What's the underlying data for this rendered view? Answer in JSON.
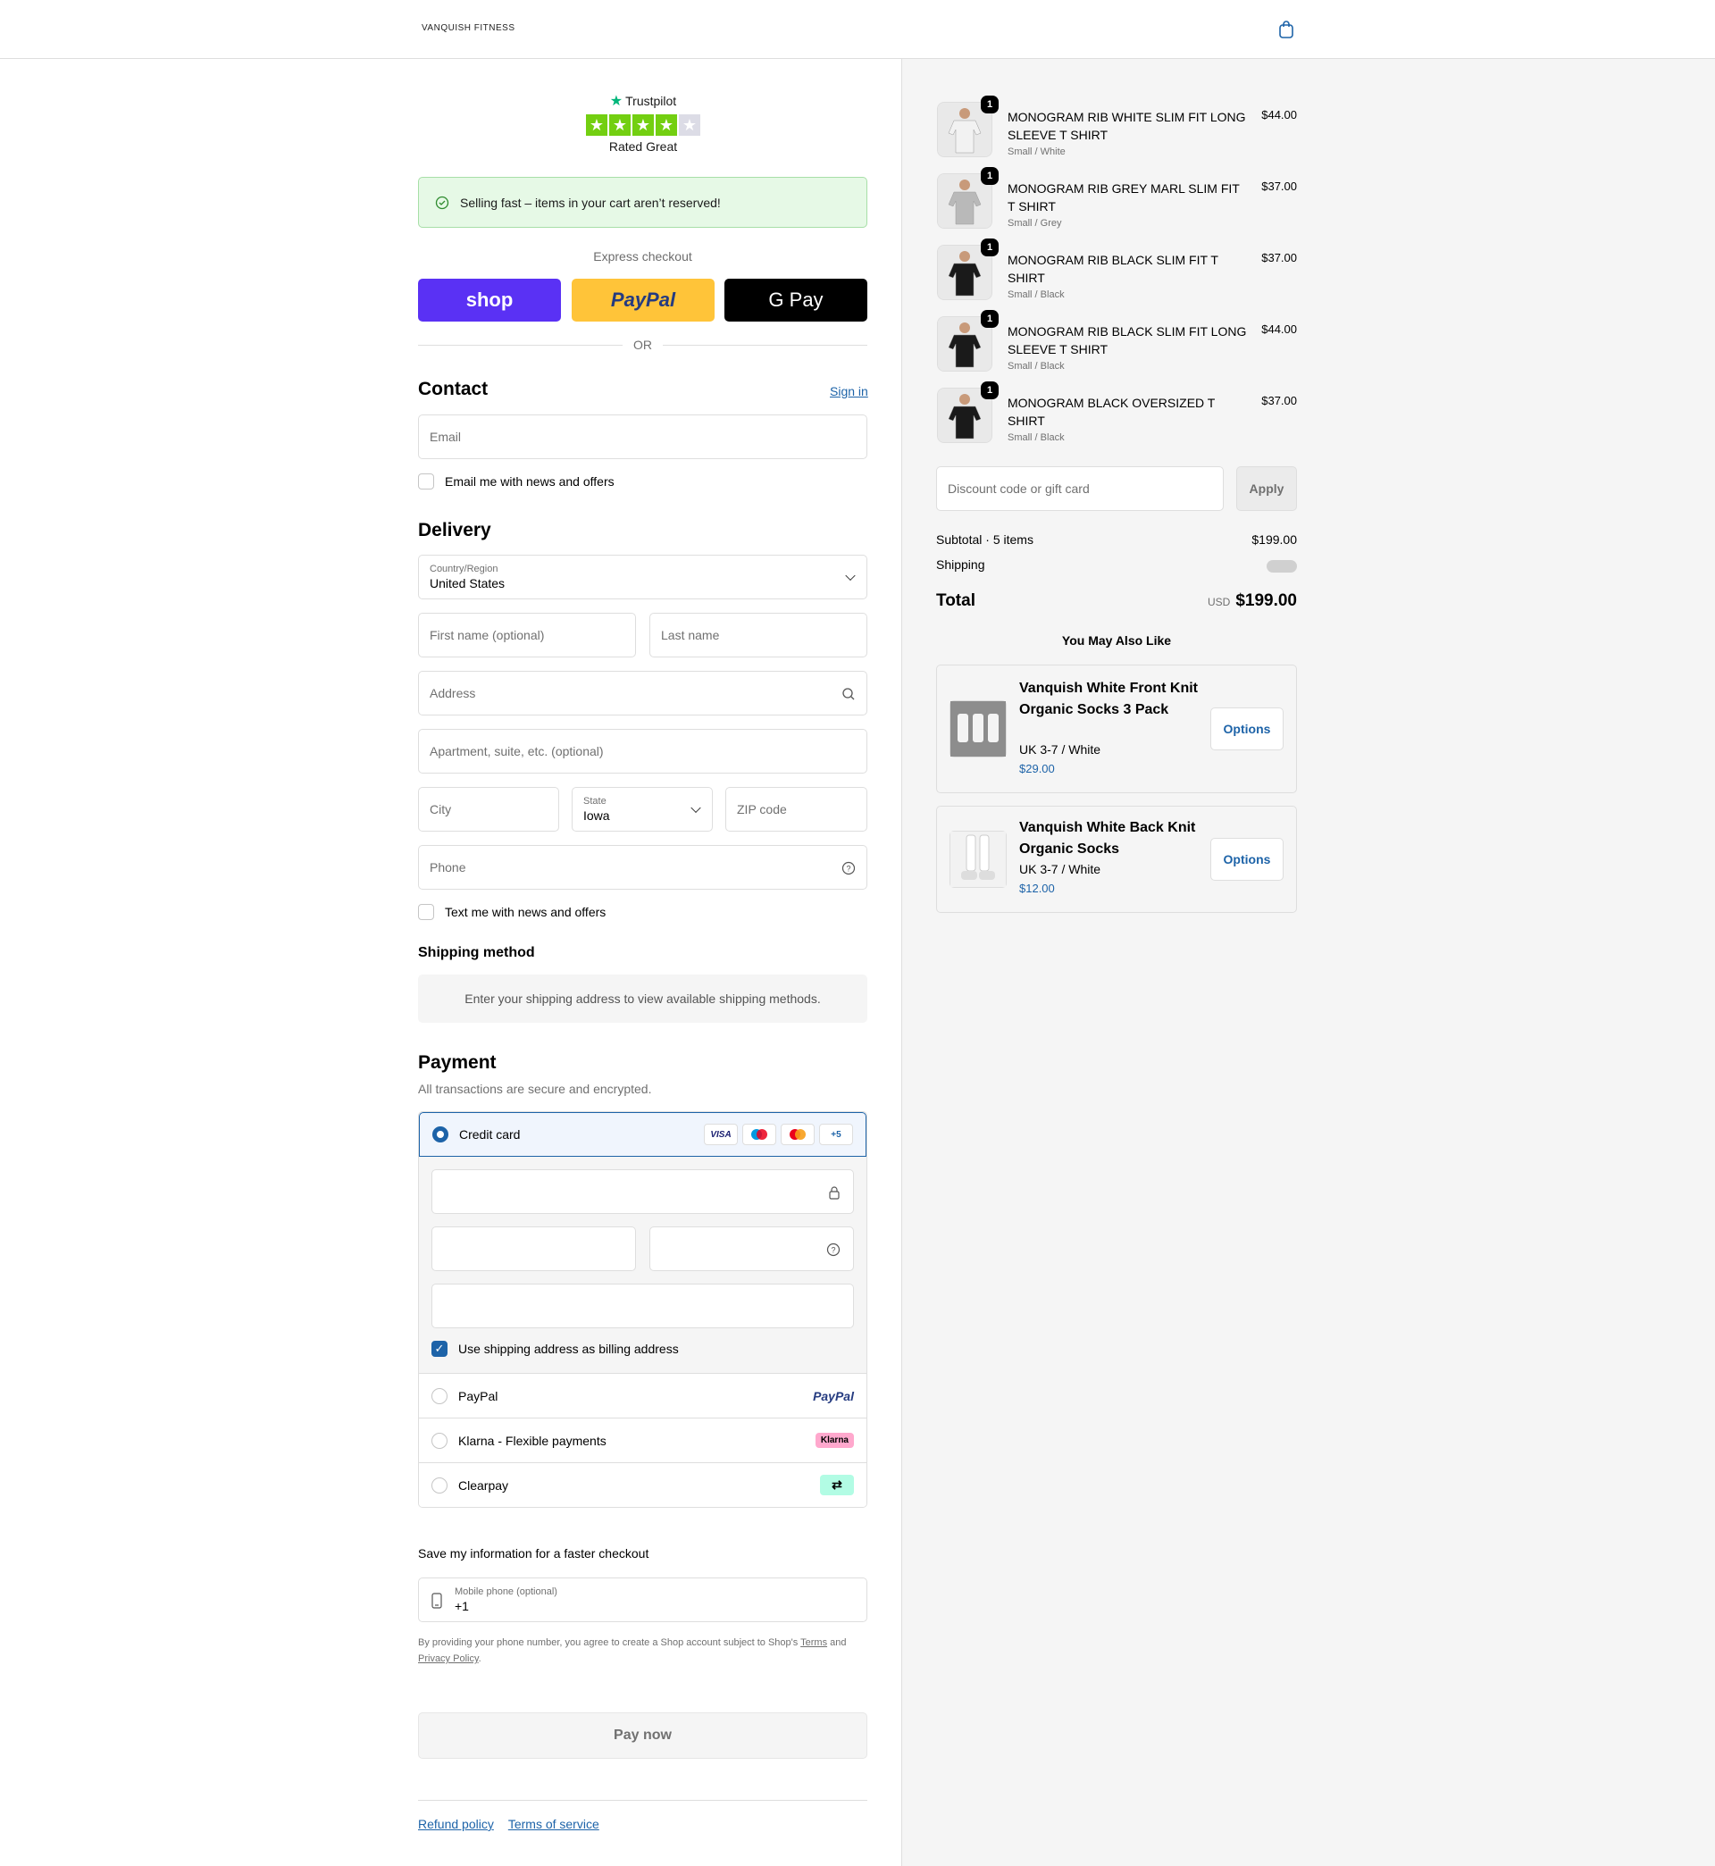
{
  "header": {
    "brand": "VANQUISH FITNESS",
    "cart_icon": "bag-icon"
  },
  "trustpilot": {
    "name": "Trustpilot",
    "rating_text": "Rated Great",
    "stars": 4,
    "max_stars": 5
  },
  "banner": {
    "text": "Selling fast – items in your cart aren’t reserved!"
  },
  "express": {
    "title": "Express checkout",
    "shop": "shop",
    "paypal": "PayPal",
    "gpay": "G Pay",
    "or": "OR"
  },
  "contact": {
    "title": "Contact",
    "sign_in": "Sign in",
    "email_placeholder": "Email",
    "news_checkbox": "Email me with news and offers"
  },
  "delivery": {
    "title": "Delivery",
    "country_label": "Country/Region",
    "country_value": "United States",
    "first_name": "First name (optional)",
    "last_name": "Last name",
    "address": "Address",
    "apartment": "Apartment, suite, etc. (optional)",
    "city": "City",
    "state_label": "State",
    "state_value": "Iowa",
    "zip": "ZIP code",
    "phone": "Phone",
    "text_checkbox": "Text me with news and offers"
  },
  "shipping_method": {
    "title": "Shipping method",
    "info": "Enter your shipping address to view available shipping methods."
  },
  "payment": {
    "title": "Payment",
    "subtitle": "All transactions are secure and encrypted.",
    "credit_card": "Credit card",
    "card_brands": [
      "VISA",
      "Maestro",
      "Mastercard",
      "+5"
    ],
    "billing_checkbox": "Use shipping address as billing address",
    "paypal": "PayPal",
    "klarna": "Klarna - Flexible payments",
    "klarna_badge": "Klarna",
    "clearpay": "Clearpay"
  },
  "save": {
    "title": "Save my information for a faster checkout",
    "mobile_label": "Mobile phone (optional)",
    "mobile_value": "+1",
    "terms_prefix": "By providing your phone number, you agree to create a Shop account subject to Shop's ",
    "terms_link": "Terms",
    "and": " and ",
    "privacy_link": "Privacy Policy",
    "period": "."
  },
  "pay_now": "Pay now",
  "footer": {
    "refund": "Refund policy",
    "terms": "Terms of service"
  },
  "cart": {
    "items": [
      {
        "name": "MONOGRAM RIB WHITE SLIM FIT LONG SLEEVE T SHIRT",
        "variant": "Small / White",
        "price": "$44.00",
        "qty": "1",
        "shirt_color": "#f2f2f2"
      },
      {
        "name": "MONOGRAM RIB GREY MARL SLIM FIT T SHIRT",
        "variant": "Small / Grey",
        "price": "$37.00",
        "qty": "1",
        "shirt_color": "#b9b9b9"
      },
      {
        "name": "MONOGRAM RIB BLACK SLIM FIT T SHIRT",
        "variant": "Small / Black",
        "price": "$37.00",
        "qty": "1",
        "shirt_color": "#1a1a1a"
      },
      {
        "name": "MONOGRAM RIB BLACK SLIM FIT LONG SLEEVE T SHIRT",
        "variant": "Small / Black",
        "price": "$44.00",
        "qty": "1",
        "shirt_color": "#1a1a1a"
      },
      {
        "name": "MONOGRAM BLACK OVERSIZED T SHIRT",
        "variant": "Small / Black",
        "price": "$37.00",
        "qty": "1",
        "shirt_color": "#1a1a1a"
      }
    ],
    "discount_placeholder": "Discount code or gift card",
    "apply": "Apply",
    "subtotal_label": "Subtotal · 5 items",
    "subtotal_value": "$199.00",
    "shipping_label": "Shipping",
    "total_label": "Total",
    "total_currency": "USD",
    "total_value": "$199.00"
  },
  "upsell": {
    "title": "You May Also Like",
    "items": [
      {
        "name": "Vanquish White Front Knit Organic Socks 3 Pack",
        "variant": "UK 3-7 / White",
        "price": "$29.00",
        "button": "Options"
      },
      {
        "name": "Vanquish White Back Knit Organic Socks",
        "variant": "UK 3-7 / White",
        "price": "$12.00",
        "button": "Options"
      }
    ]
  },
  "colors": {
    "accent": "#1d63a8",
    "shop": "#5a31f4",
    "paypal": "#ffc439",
    "trustpilot_green": "#73cf11",
    "banner_bg": "#e6f9e6"
  }
}
